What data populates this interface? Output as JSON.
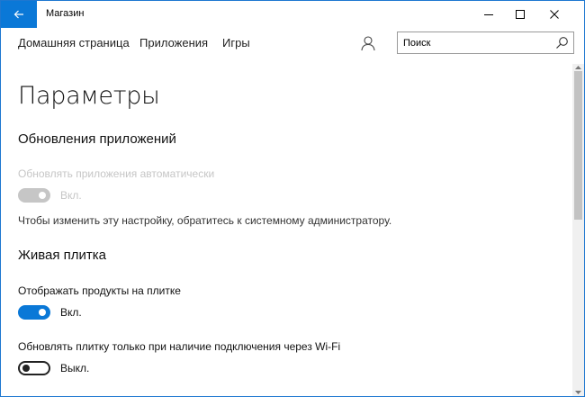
{
  "titlebar": {
    "app_title": "Магазин"
  },
  "nav": {
    "items": [
      "Домашняя страница",
      "Приложения",
      "Игры"
    ],
    "search": {
      "value": "",
      "placeholder": "Поиск"
    }
  },
  "page": {
    "title": "Параметры"
  },
  "sections": {
    "updates": {
      "heading": "Обновления приложений",
      "auto_update_label": "Обновлять приложения автоматически",
      "auto_update_state": "Вкл.",
      "admin_note": "Чтобы изменить эту настройку, обратитесь к системному администратору."
    },
    "live_tile": {
      "heading": "Живая плитка",
      "show_products_label": "Отображать продукты на плитке",
      "show_products_state": "Вкл.",
      "wifi_only_label": "Обновлять плитку только при наличие подключения через Wi-Fi",
      "wifi_only_state": "Выкл."
    }
  },
  "colors": {
    "accent": "#0a78d7",
    "disabled": "#c6c6c6"
  },
  "icons": [
    "back-arrow-icon",
    "minimize-icon",
    "maximize-icon",
    "close-icon",
    "user-icon",
    "search-icon"
  ]
}
